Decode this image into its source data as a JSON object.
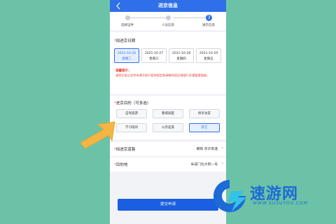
{
  "navbar": {
    "title": "进京信息",
    "back_icon": "chevron-left-icon"
  },
  "steps": [
    {
      "label": "选择证件",
      "number": ""
    },
    {
      "label": "人员信息",
      "number": ""
    },
    {
      "label": "进京信息",
      "number": "3"
    }
  ],
  "date_section": {
    "title": "拟进京日期",
    "required_mark": "*",
    "dates": [
      {
        "date": "2021-10-26",
        "weekday": "星期二",
        "selected": true
      },
      {
        "date": "2021-10-27",
        "weekday": "星期三",
        "selected": false
      },
      {
        "date": "2021-10-28",
        "weekday": "星期四",
        "selected": false
      },
      {
        "date": "2021-10-29",
        "weekday": "星期五",
        "selected": false
      }
    ],
    "tip_title": "温馨提示：",
    "tip_text": "请您在抵达北京市通号前行相关规定和高峰时段区域限行交通管理措施。"
  },
  "purpose_section": {
    "title": "进京目的（可多选）",
    "required_mark": "*",
    "options": [
      {
        "label": "自驾旅游",
        "selected": false
      },
      {
        "label": "看病就医",
        "selected": false
      },
      {
        "label": "探亲访友",
        "selected": false
      },
      {
        "label": "学习培训",
        "selected": false
      },
      {
        "label": "公务差旅",
        "selected": false
      },
      {
        "label": "其它",
        "selected": true
      }
    ]
  },
  "route_row": {
    "label": "拟进京道路",
    "required_mark": "*",
    "value": "朝阳 京沪高速"
  },
  "destination_row": {
    "label": "目的地",
    "required_mark": "*",
    "value": "阜成门北大街一号"
  },
  "submit": {
    "label": "提交申请"
  },
  "watermark": {
    "name": "速游网",
    "url": "WWW.SUSUYOU.COM"
  },
  "colors": {
    "primary": "#2f6fe9",
    "accent_arrow": "#f5b544",
    "background": "#6cc2a6"
  }
}
